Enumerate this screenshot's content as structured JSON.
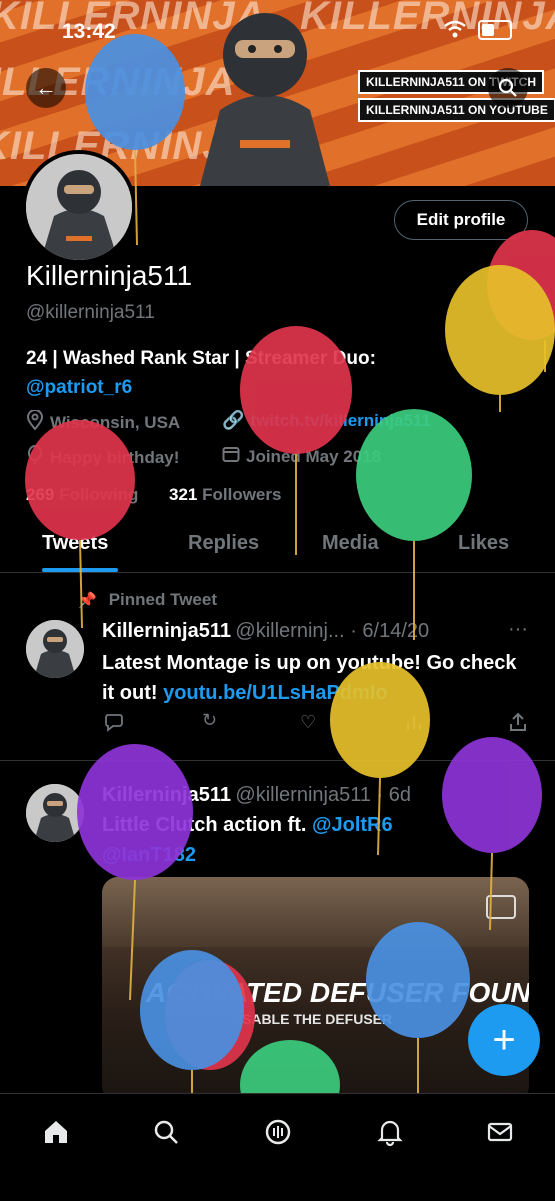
{
  "status": {
    "time": "13:42"
  },
  "banner": {
    "bg_words": [
      "KILLERNINJA",
      "KILLERNINJA",
      "KILLERNINJA",
      "KILLERNINJA"
    ],
    "tag_twitch": "KILLERNINJA511 ON TWITCH",
    "tag_youtube": "KILLERNINJA511 ON YOUTUBE"
  },
  "profile": {
    "edit_label": "Edit profile",
    "display_name": "Killerninja511",
    "handle": "@killerninja511",
    "bio_line1": "24 | Washed Rank Star | Streamer Duo:",
    "bio_mention": "@patriot_r6",
    "location": "Wisconsin, USA",
    "website": "twitch.tv/killerninja511",
    "birthday": "Happy birthday!",
    "joined": "Joined May 2018",
    "following_count": "269",
    "following_label": "Following",
    "followers_count": "321",
    "followers_label": "Followers"
  },
  "tabs": [
    "Tweets",
    "Replies",
    "Media",
    "Likes"
  ],
  "tweets": [
    {
      "pinned_label": "Pinned Tweet",
      "name": "Killerninja511",
      "handle_date": "@killerninj... · 6/14/20",
      "text": "Latest Montage is up on youtube! Go check it out!",
      "link": "youtu.be/U1LsHaPdmIo",
      "more": "···"
    },
    {
      "name": "Killerninja511",
      "handle_date": "@killerninja511 · 6d",
      "text": "Little Clutch action ft.",
      "mention1": "@JoltR6",
      "mention2": "@IanT182",
      "media_title": "ACTIVATED DEFUSER FOUND",
      "media_sub": "DISABLE THE DEFUSER"
    }
  ],
  "colors": {
    "accent": "#1d9bf0",
    "banner": "#e0702a"
  }
}
